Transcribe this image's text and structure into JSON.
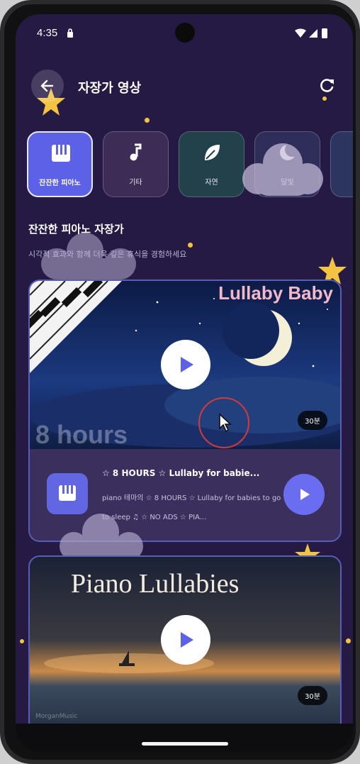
{
  "status_bar": {
    "time": "4:35"
  },
  "header": {
    "title": "자장가 영상"
  },
  "categories": [
    {
      "label": "잔잔한 피아노",
      "icon": "piano-icon",
      "active": true
    },
    {
      "label": "기타",
      "icon": "music-note-icon",
      "active": false
    },
    {
      "label": "자연",
      "icon": "leaf-icon",
      "active": false
    },
    {
      "label": "달빛",
      "icon": "moon-icon",
      "active": false
    }
  ],
  "section": {
    "title": "잔잔한 피아노 자장가",
    "subtitle": "시각적 효과와 함께 더욱 깊은 휴식을 경험하세요"
  },
  "videos": [
    {
      "thumbnail_text_top": "Lullaby Baby",
      "thumbnail_text_bottom": "8 hours",
      "duration": "30분",
      "title": "☆ 8 HOURS ☆ Lullaby for babie...",
      "description": "piano 테마의 ☆ 8 HOURS ☆ Lullaby for babies to go to sleep ♫ ☆ NO ADS ☆ PIA..."
    },
    {
      "thumbnail_text_top": "Piano Lullabies",
      "thumbnail_watermark": "MorganMusic",
      "duration": "30분"
    }
  ],
  "colors": {
    "background": "#241a44",
    "accent": "#5d61e8",
    "card_border": "#5a5db4",
    "star": "#f5c342"
  }
}
